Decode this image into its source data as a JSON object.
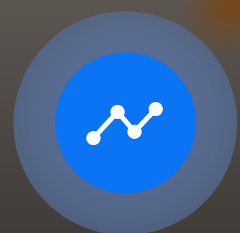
{
  "button": {
    "icon": "trend-line-chart-icon",
    "accent_color": "#0b74f5",
    "icon_color": "#ffffff"
  }
}
